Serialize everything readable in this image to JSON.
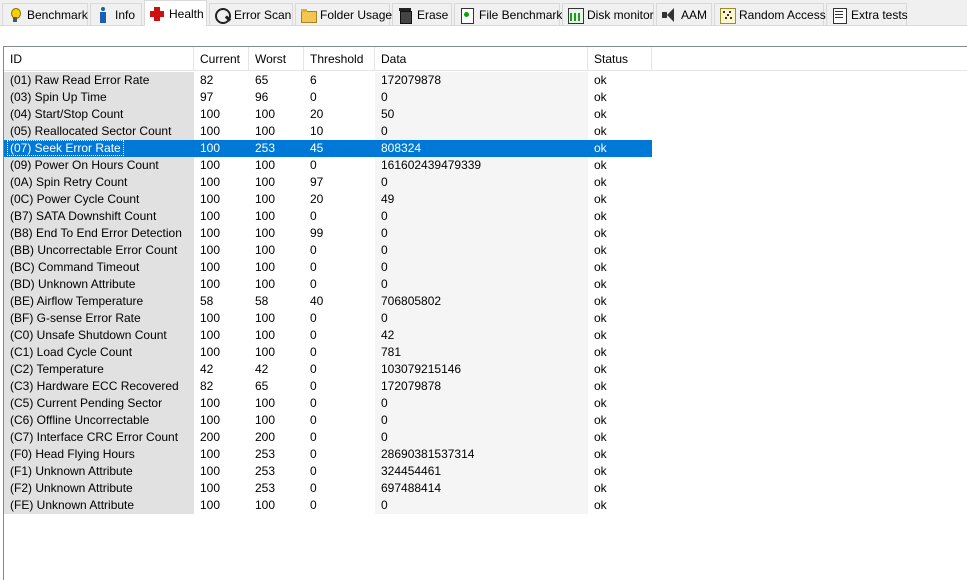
{
  "tabs": [
    {
      "label": "Benchmark",
      "icon": "lightbulb-icon"
    },
    {
      "label": "Info",
      "icon": "info-icon"
    },
    {
      "label": "Health",
      "icon": "health-cross-icon",
      "active": true
    },
    {
      "label": "Error Scan",
      "icon": "magnifier-icon"
    },
    {
      "label": "Folder Usage",
      "icon": "folder-icon"
    },
    {
      "label": "Erase",
      "icon": "trash-icon"
    },
    {
      "label": "File Benchmark",
      "icon": "file-benchmark-icon"
    },
    {
      "label": "Disk monitor",
      "icon": "disk-monitor-icon"
    },
    {
      "label": "AAM",
      "icon": "speaker-icon"
    },
    {
      "label": "Random Access",
      "icon": "random-access-icon"
    },
    {
      "label": "Extra tests",
      "icon": "extra-tests-icon"
    }
  ],
  "table": {
    "columns": [
      "ID",
      "Current",
      "Worst",
      "Threshold",
      "Data",
      "Status"
    ],
    "selected_row": 4,
    "rows": [
      [
        "(01) Raw Read Error Rate",
        "82",
        "65",
        "6",
        "172079878",
        "ok"
      ],
      [
        "(03) Spin Up Time",
        "97",
        "96",
        "0",
        "0",
        "ok"
      ],
      [
        "(04) Start/Stop Count",
        "100",
        "100",
        "20",
        "50",
        "ok"
      ],
      [
        "(05) Reallocated Sector Count",
        "100",
        "100",
        "10",
        "0",
        "ok"
      ],
      [
        "(07) Seek Error Rate",
        "100",
        "253",
        "45",
        "808324",
        "ok"
      ],
      [
        "(09) Power On Hours Count",
        "100",
        "100",
        "0",
        "161602439479339",
        "ok"
      ],
      [
        "(0A) Spin Retry Count",
        "100",
        "100",
        "97",
        "0",
        "ok"
      ],
      [
        "(0C) Power Cycle Count",
        "100",
        "100",
        "20",
        "49",
        "ok"
      ],
      [
        "(B7) SATA Downshift Count",
        "100",
        "100",
        "0",
        "0",
        "ok"
      ],
      [
        "(B8) End To End Error Detection",
        "100",
        "100",
        "99",
        "0",
        "ok"
      ],
      [
        "(BB) Uncorrectable Error Count",
        "100",
        "100",
        "0",
        "0",
        "ok"
      ],
      [
        "(BC) Command Timeout",
        "100",
        "100",
        "0",
        "0",
        "ok"
      ],
      [
        "(BD) Unknown Attribute",
        "100",
        "100",
        "0",
        "0",
        "ok"
      ],
      [
        "(BE) Airflow Temperature",
        "58",
        "58",
        "40",
        "706805802",
        "ok"
      ],
      [
        "(BF) G-sense Error Rate",
        "100",
        "100",
        "0",
        "0",
        "ok"
      ],
      [
        "(C0) Unsafe Shutdown Count",
        "100",
        "100",
        "0",
        "42",
        "ok"
      ],
      [
        "(C1) Load Cycle Count",
        "100",
        "100",
        "0",
        "781",
        "ok"
      ],
      [
        "(C2) Temperature",
        "42",
        "42",
        "0",
        "103079215146",
        "ok"
      ],
      [
        "(C3) Hardware ECC Recovered",
        "82",
        "65",
        "0",
        "172079878",
        "ok"
      ],
      [
        "(C5) Current Pending Sector",
        "100",
        "100",
        "0",
        "0",
        "ok"
      ],
      [
        "(C6) Offline Uncorrectable",
        "100",
        "100",
        "0",
        "0",
        "ok"
      ],
      [
        "(C7) Interface CRC Error Count",
        "200",
        "200",
        "0",
        "0",
        "ok"
      ],
      [
        "(F0) Head Flying Hours",
        "100",
        "253",
        "0",
        "28690381537314",
        "ok"
      ],
      [
        "(F1) Unknown Attribute",
        "100",
        "253",
        "0",
        "324454461",
        "ok"
      ],
      [
        "(F2) Unknown Attribute",
        "100",
        "253",
        "0",
        "697488414",
        "ok"
      ],
      [
        "(FE) Unknown Attribute",
        "100",
        "100",
        "0",
        "0",
        "ok"
      ]
    ]
  }
}
